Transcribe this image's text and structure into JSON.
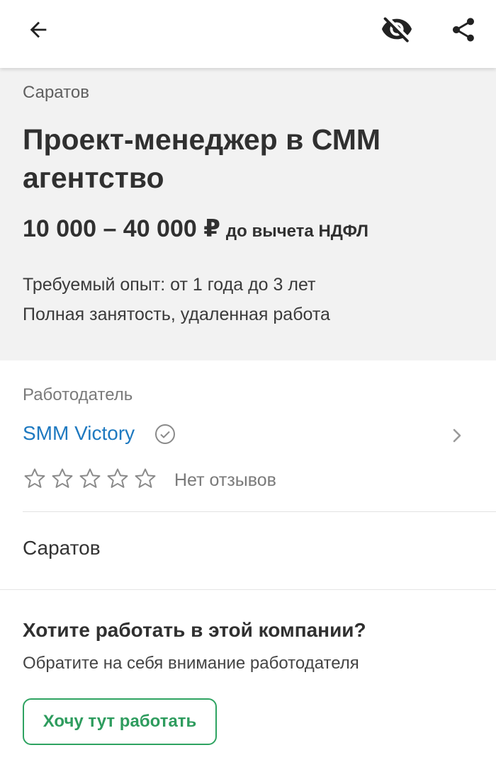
{
  "header": {
    "back_icon": "arrow-left-icon",
    "hide_icon": "eye-off-icon",
    "share_icon": "share-icon"
  },
  "vacancy": {
    "city": "Саратов",
    "title": "Проект-менеджер в СММ агентство",
    "salary": "10 000 – 40 000 ₽",
    "salary_note": "до вычета НДФЛ",
    "experience": "Требуемый опыт: от 1 года до 3 лет",
    "employment": "Полная занятость, удаленная работа"
  },
  "employer": {
    "label": "Работодатель",
    "name": "SMM Victory",
    "verified_icon": "verified-check-icon",
    "rating_stars": 0,
    "rating_max": 5,
    "reviews_text": "Нет отзывов"
  },
  "address": {
    "city": "Саратов"
  },
  "cta": {
    "title": "Хотите работать в этой компании?",
    "subtitle": "Обратите на себя внимание работодателя",
    "button_label": "Хочу тут работать"
  },
  "colors": {
    "accent_link": "#1e79c0",
    "accent_green": "#2ea361",
    "header_bg": "#f2f2f2"
  }
}
